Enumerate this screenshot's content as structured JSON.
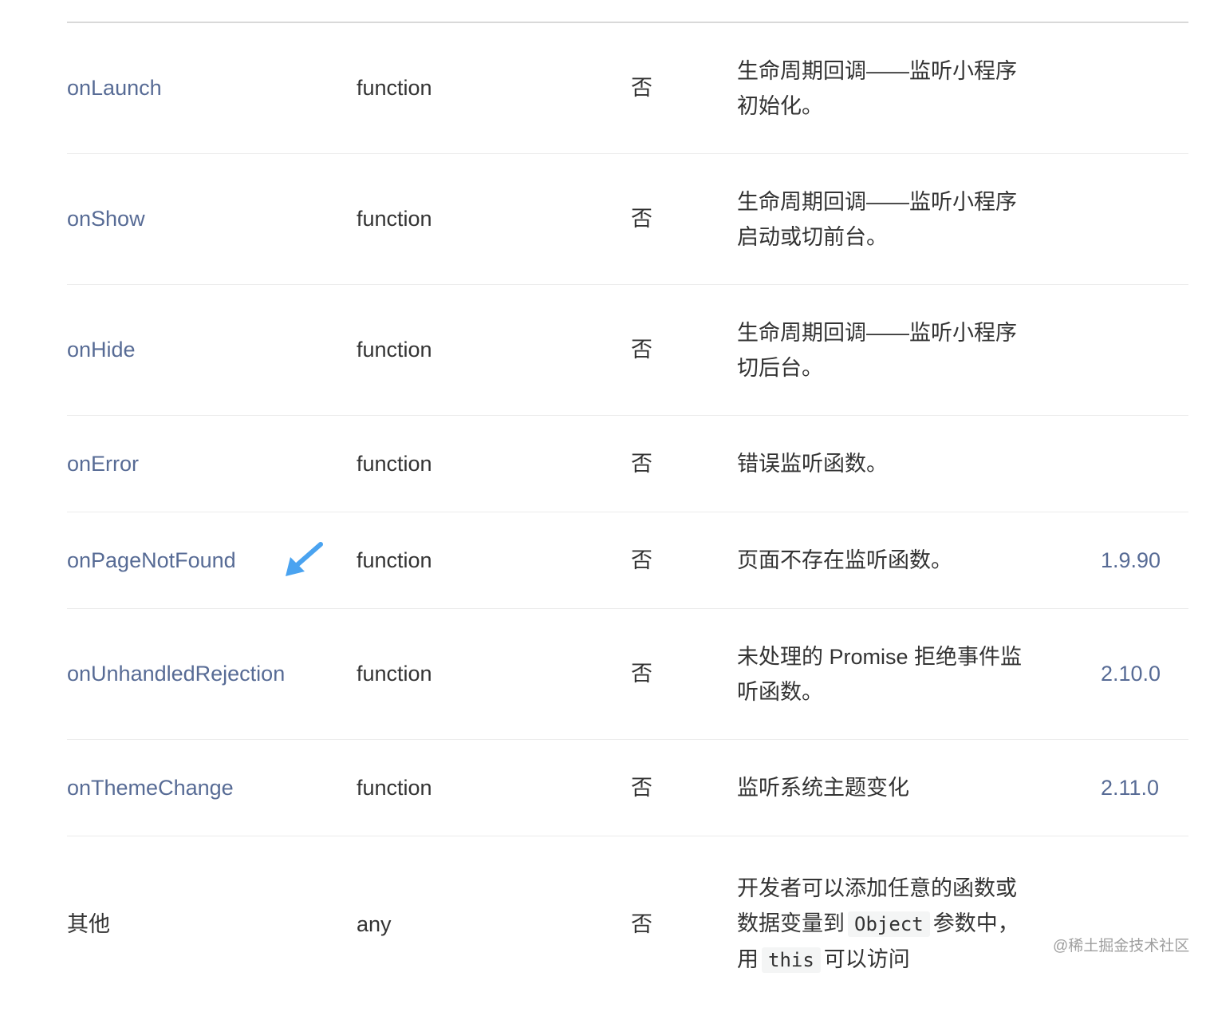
{
  "rows": [
    {
      "name": "onLaunch",
      "type": "function",
      "required": "否",
      "desc_parts": [
        "生命周期回调——监听小程序",
        "初始化。"
      ],
      "version": ""
    },
    {
      "name": "onShow",
      "type": "function",
      "required": "否",
      "desc_parts": [
        "生命周期回调——监听小程序",
        "启动或切前台。"
      ],
      "version": ""
    },
    {
      "name": "onHide",
      "type": "function",
      "required": "否",
      "desc_parts": [
        "生命周期回调——监听小程序",
        "切后台。"
      ],
      "version": ""
    },
    {
      "name": "onError",
      "type": "function",
      "required": "否",
      "desc_parts": [
        "错误监听函数。"
      ],
      "version": ""
    },
    {
      "name": "onPageNotFound",
      "type": "function",
      "required": "否",
      "desc_parts": [
        "页面不存在监听函数。"
      ],
      "version": "1.9.90"
    },
    {
      "name": "onUnhandledRejection",
      "type": "function",
      "required": "否",
      "desc_parts": [
        "未处理的 Promise 拒绝事件监",
        "听函数。"
      ],
      "version": "2.10.0"
    },
    {
      "name": "onThemeChange",
      "type": "function",
      "required": "否",
      "desc_parts": [
        "监听系统主题变化"
      ],
      "version": "2.11.0"
    },
    {
      "name": "其他",
      "type": "any",
      "required": "否",
      "desc_parts": [
        "开发者可以添加任意的函数或",
        "数据变量到",
        "Object",
        "参数中，",
        "用",
        "this",
        "可以访问"
      ],
      "version": ""
    }
  ],
  "arrow": {
    "icon": "arrow-down-left-icon",
    "color": "#4aa3f0"
  },
  "watermark": "@稀土掘金技术社区",
  "colors": {
    "link": "#576b95",
    "text": "#333333",
    "divider": "#ececec",
    "header_line": "#d9d9d9"
  }
}
